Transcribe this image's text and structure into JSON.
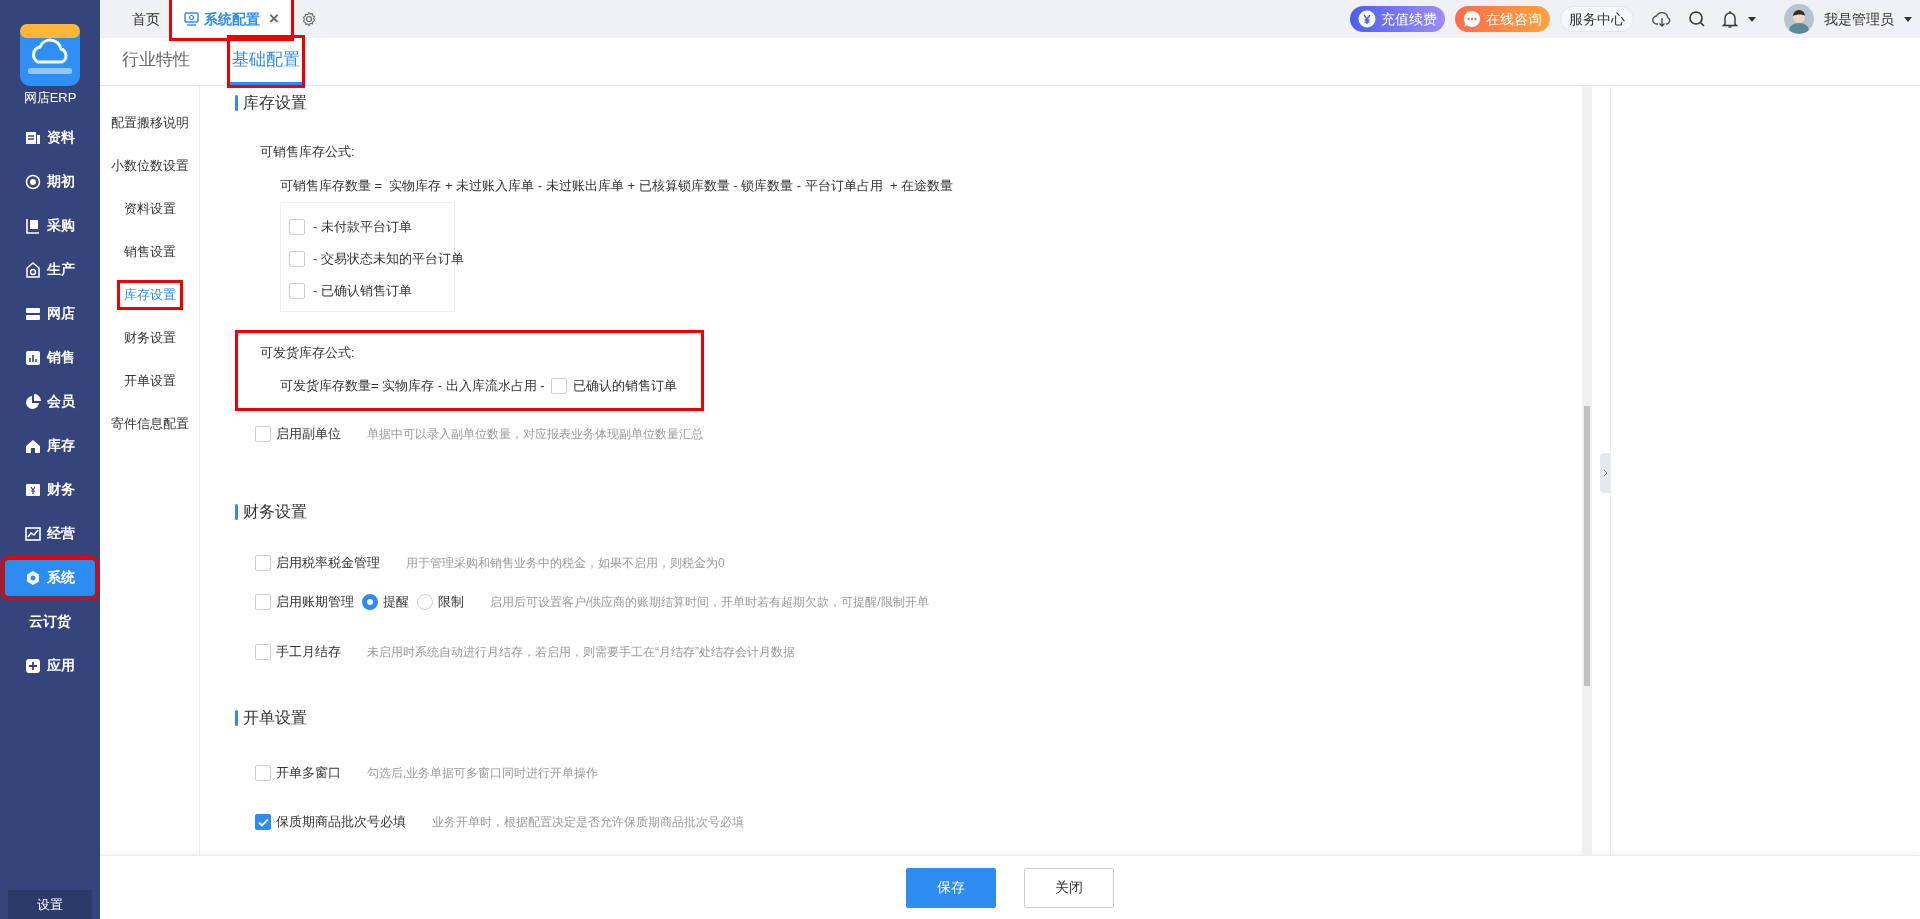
{
  "app": {
    "name": "网店ERP"
  },
  "nav": [
    {
      "label": "资料",
      "kind": "icon",
      "selected": false,
      "highlighted": false
    },
    {
      "label": "期初",
      "kind": "icon",
      "selected": false,
      "highlighted": false
    },
    {
      "label": "采购",
      "kind": "icon",
      "selected": false,
      "highlighted": false
    },
    {
      "label": "生产",
      "kind": "icon",
      "selected": false,
      "highlighted": false
    },
    {
      "label": "网店",
      "kind": "icon",
      "selected": false,
      "highlighted": false
    },
    {
      "label": "销售",
      "kind": "icon",
      "selected": false,
      "highlighted": false
    },
    {
      "label": "会员",
      "kind": "icon",
      "selected": false,
      "highlighted": false
    },
    {
      "label": "库存",
      "kind": "icon",
      "selected": false,
      "highlighted": false
    },
    {
      "label": "财务",
      "kind": "icon",
      "selected": false,
      "highlighted": false
    },
    {
      "label": "经营",
      "kind": "icon",
      "selected": false,
      "highlighted": false
    },
    {
      "label": "系统",
      "kind": "icon",
      "selected": true,
      "highlighted": true
    },
    {
      "label": "云订货",
      "kind": "plain",
      "selected": false,
      "highlighted": false
    },
    {
      "label": "应用",
      "kind": "icon",
      "selected": false,
      "highlighted": false
    }
  ],
  "settings_button": "设置",
  "tabs": [
    {
      "label": "首页",
      "selected": false,
      "highlighted": false
    },
    {
      "label": "系统配置",
      "selected": true,
      "highlighted": true,
      "close": "×"
    }
  ],
  "header": {
    "recharge": "充值续费",
    "consult": "在线咨询",
    "service": "服务中心",
    "user": "我是管理员"
  },
  "subtabs": [
    {
      "label": "行业特性",
      "selected": false,
      "highlighted": false
    },
    {
      "label": "基础配置",
      "selected": true,
      "highlighted": true
    }
  ],
  "side_menu": [
    {
      "label": "配置搬移说明",
      "selected": false,
      "highlighted": false
    },
    {
      "label": "小数位数设置",
      "selected": false,
      "highlighted": false
    },
    {
      "label": "资料设置",
      "selected": false,
      "highlighted": false
    },
    {
      "label": "销售设置",
      "selected": false,
      "highlighted": false
    },
    {
      "label": "库存设置",
      "selected": true,
      "highlighted": true
    },
    {
      "label": "财务设置",
      "selected": false,
      "highlighted": false
    },
    {
      "label": "开单设置",
      "selected": false,
      "highlighted": false
    },
    {
      "label": "寄件信息配置",
      "selected": false,
      "highlighted": false
    }
  ],
  "sections": [
    {
      "title": "库存设置",
      "rows": [
        {
          "kind": "formula",
          "label": "可销售库存公式:",
          "expression": "可销售库存数量 =  实物库存 + 未过账入库单 - 未过账出库单 + 已核算锁库数量 - 锁库数量 - 平台订单占用  + 在途数量",
          "options": [
            {
              "label": "- 未付款平台订单",
              "checked": false
            },
            {
              "label": "- 交易状态未知的平台订单",
              "checked": false
            },
            {
              "label": "- 已确认销售订单",
              "checked": false
            }
          ]
        },
        {
          "kind": "inline_formula",
          "label": "可发货库存公式:",
          "expression": "可发货库存数量= 实物库存 - 出入库流水占用 -",
          "highlighted": true,
          "option": {
            "label": "已确认的销售订单",
            "checked": false
          }
        },
        {
          "kind": "option",
          "label": "启用副单位",
          "checked": false,
          "hint": "单据中可以录入副单位数量，对应报表业务体现副单位数量汇总"
        }
      ]
    },
    {
      "title": "财务设置",
      "rows": [
        {
          "kind": "option",
          "label": "启用税率税金管理",
          "checked": false,
          "hint": "用于管理采购和销售业务中的税金，如果不启用，则税金为0"
        },
        {
          "kind": "radio_option",
          "label": "启用账期管理",
          "checked": false,
          "choices": [
            {
              "label": "提醒",
              "selected": true
            },
            {
              "label": "限制",
              "selected": false
            }
          ],
          "hint": "启用后可设置客户/供应商的账期结算时间，开单时若有超期欠款，可提醒/限制开单"
        },
        {
          "kind": "option",
          "label": "手工月结存",
          "checked": false,
          "hint": "未启用时系统自动进行月结存，若启用，则需要手工在“月结存”处结存会计月数据"
        }
      ]
    },
    {
      "title": "开单设置",
      "rows": [
        {
          "kind": "option",
          "label": "开单多窗口",
          "checked": false,
          "hint": "勾选后,业务单据可多窗口同时进行开单操作"
        },
        {
          "kind": "option",
          "label": "保质期商品批次号必填",
          "checked": true,
          "hint": "业务开单时，根据配置决定是否允许保质期商品批次号必填"
        }
      ]
    }
  ],
  "footer_buttons": [
    {
      "label": "保存",
      "kind": "primary"
    },
    {
      "label": "关闭",
      "kind": "default"
    }
  ]
}
